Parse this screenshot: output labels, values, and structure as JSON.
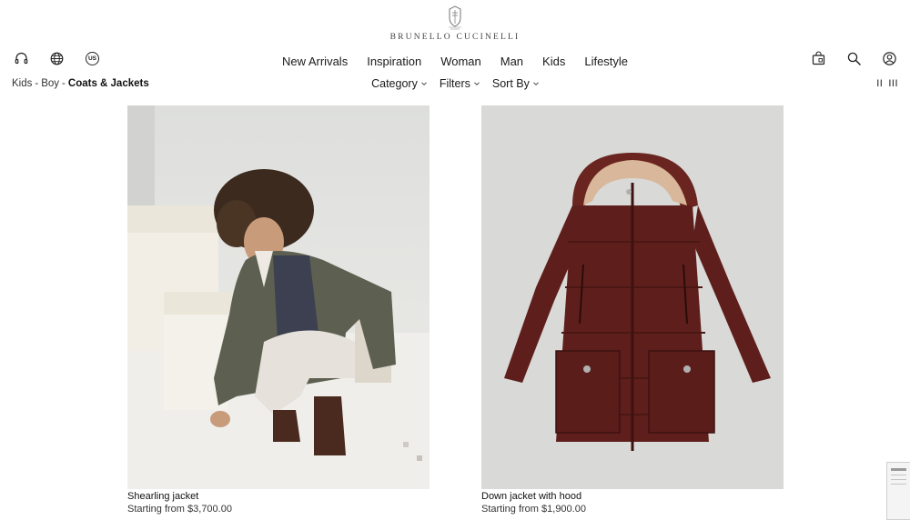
{
  "brand": {
    "name": "BRUNELLO CUCINELLI",
    "logo_icon": "crest-icon"
  },
  "utility_left": [
    {
      "name": "headset-icon"
    },
    {
      "name": "globe-icon"
    },
    {
      "name": "country-badge",
      "label": "US"
    }
  ],
  "utility_right": [
    "bag-icon",
    "search-icon",
    "account-icon"
  ],
  "nav": {
    "items": [
      "New Arrivals",
      "Inspiration",
      "Woman",
      "Man",
      "Kids",
      "Lifestyle"
    ]
  },
  "breadcrumb": {
    "items": [
      "Kids",
      "Boy"
    ],
    "current": "Coats & Jackets",
    "separator": "-"
  },
  "filters": {
    "category": "Category",
    "filters": "Filters",
    "sort": "Sort By"
  },
  "grid_toggle": {
    "two": "II",
    "three": "III"
  },
  "products": [
    {
      "name": "Shearling jacket",
      "price": "Starting from $3,700.00"
    },
    {
      "name": "Down jacket with hood",
      "price": "Starting from $1,900.00"
    }
  ],
  "colors": {
    "jacket_green": "#5d6050",
    "down_jacket": "#5e1f1c",
    "hood_lining": "#d8b79a"
  }
}
